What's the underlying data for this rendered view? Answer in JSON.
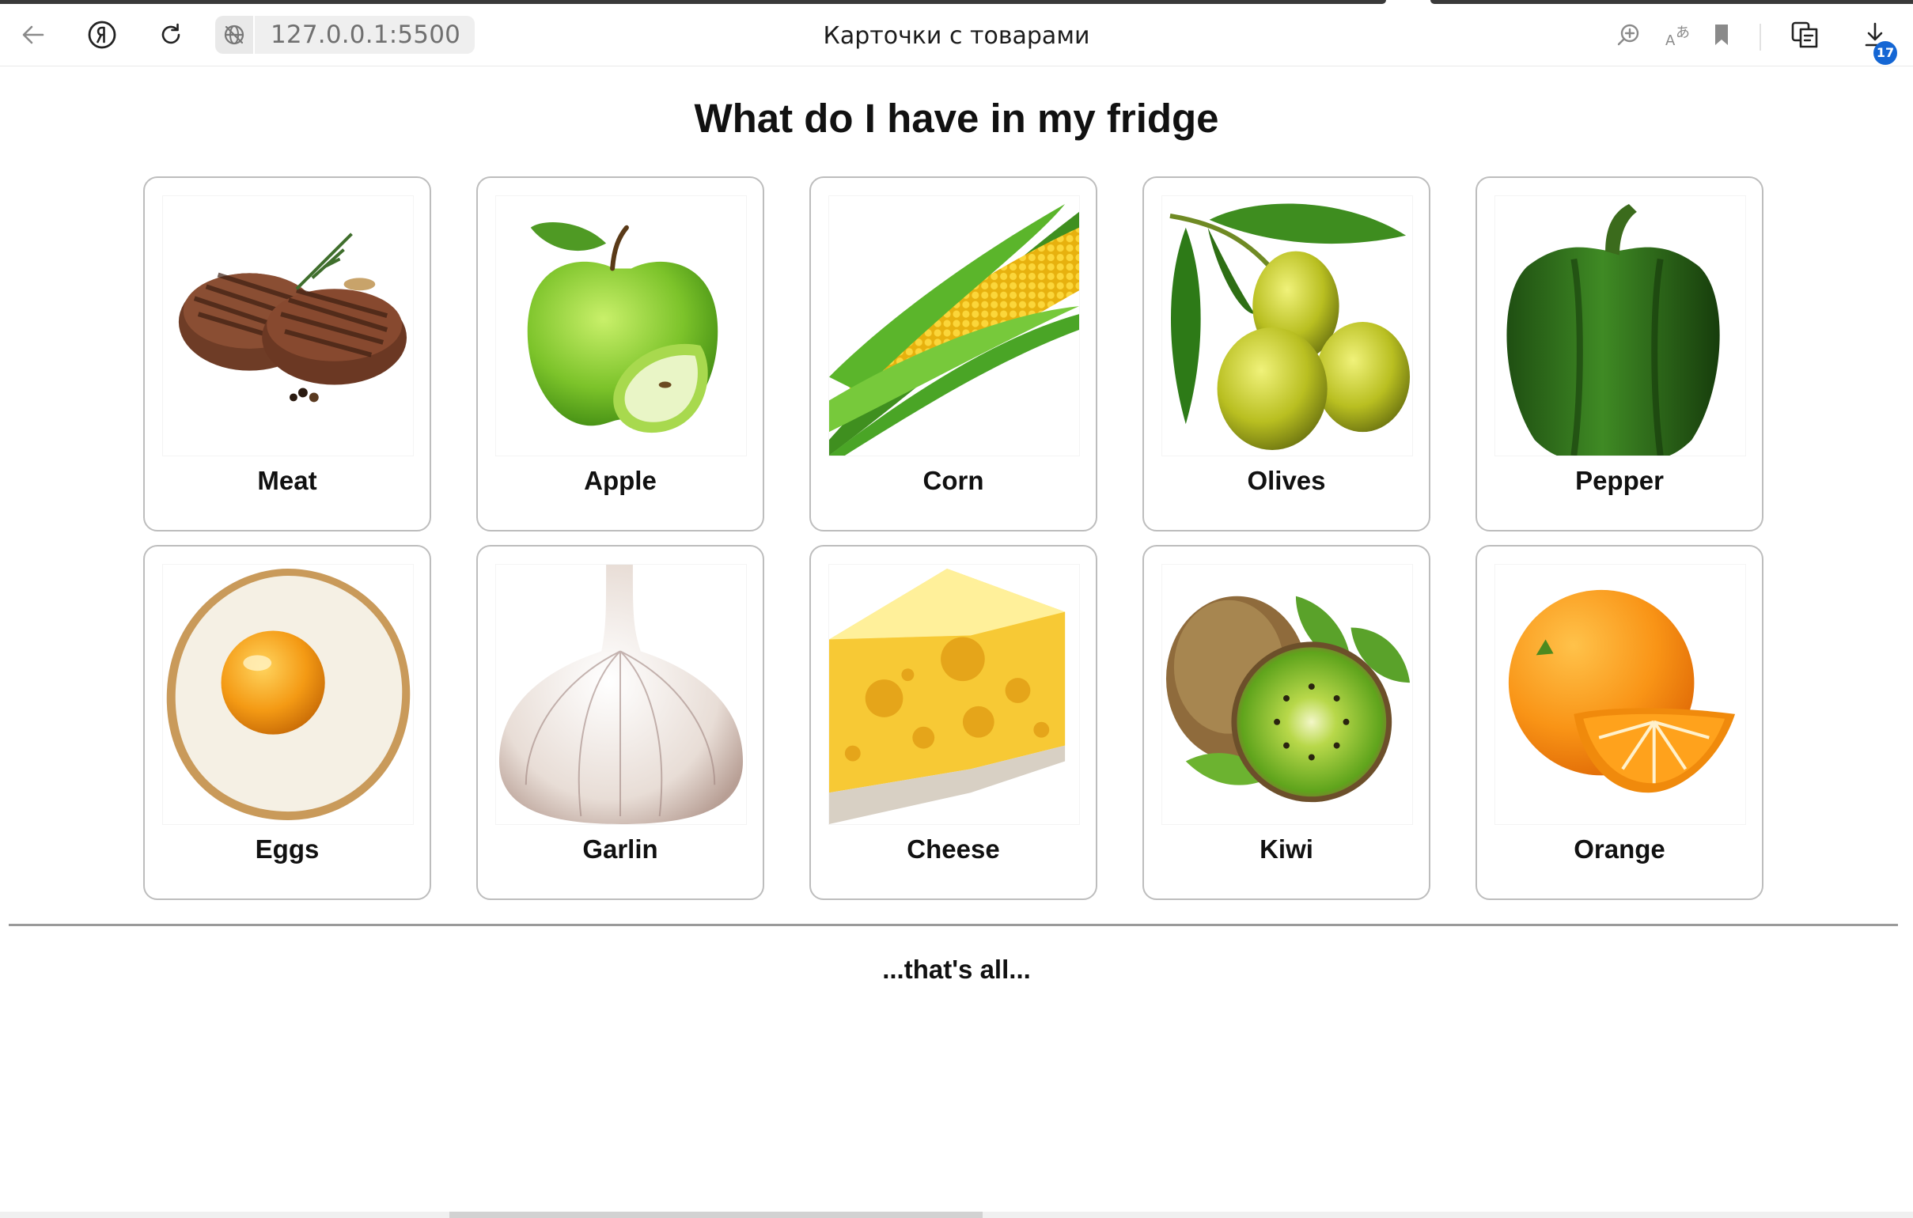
{
  "browser": {
    "address": "127.0.0.1:5500",
    "tab_title": "Карточки с товарами",
    "downloads_badge": "17"
  },
  "page": {
    "title": "What do I have in my fridge",
    "footer": "...that's all..."
  },
  "products": [
    {
      "name": "Meat",
      "icon": "meat-image"
    },
    {
      "name": "Apple",
      "icon": "apple-image"
    },
    {
      "name": "Corn",
      "icon": "corn-image"
    },
    {
      "name": "Olives",
      "icon": "olives-image"
    },
    {
      "name": "Pepper",
      "icon": "pepper-image"
    },
    {
      "name": "Eggs",
      "icon": "egg-image"
    },
    {
      "name": "Garlin",
      "icon": "garlic-image"
    },
    {
      "name": "Cheese",
      "icon": "cheese-image"
    },
    {
      "name": "Kiwi",
      "icon": "kiwi-image"
    },
    {
      "name": "Orange",
      "icon": "orange-image"
    }
  ],
  "colors": {
    "card_border": "#bdbdbd",
    "badge": "#1466d4",
    "divider": "#9a9a9a"
  }
}
